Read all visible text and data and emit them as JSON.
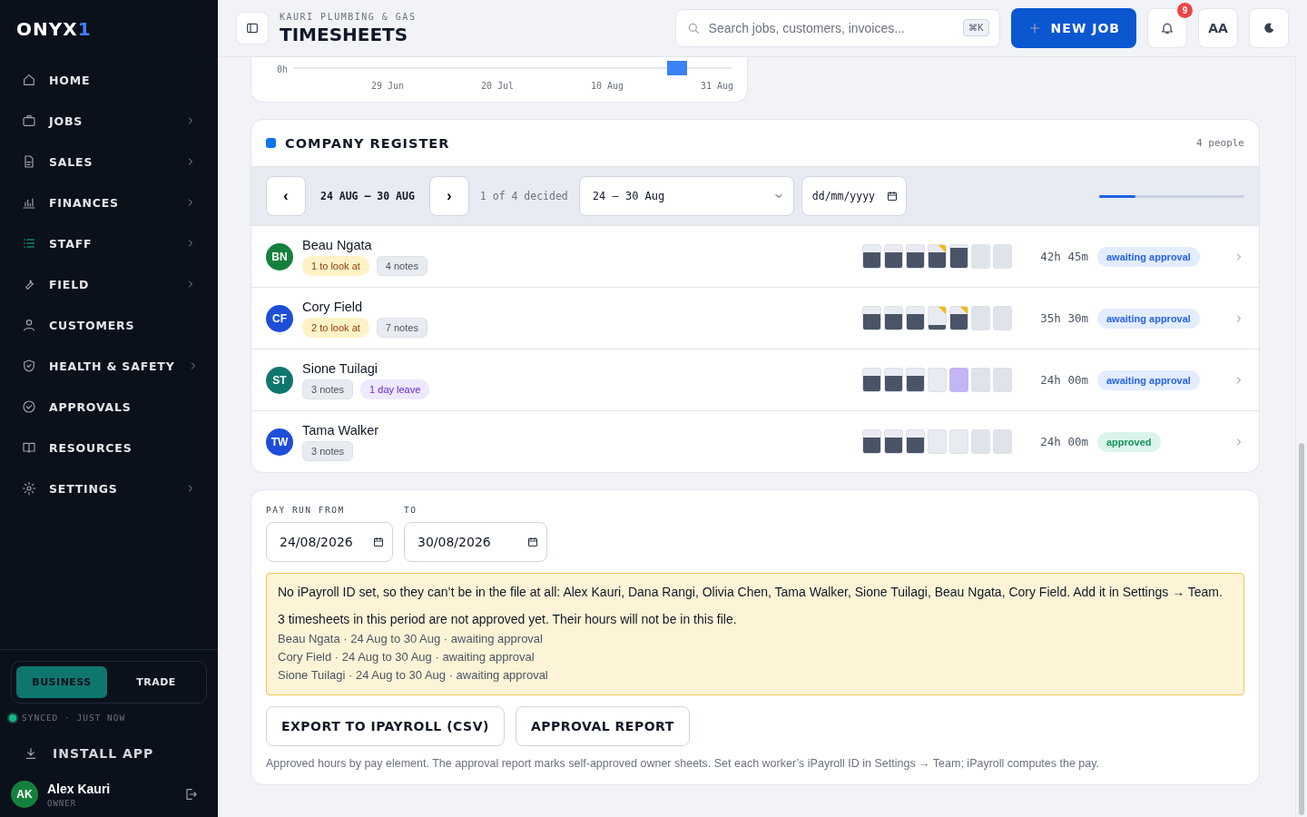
{
  "sidebar": {
    "logo": {
      "text": "ONYX",
      "accent": "1"
    },
    "items": [
      {
        "label": "HOME",
        "submenu": false,
        "selected": false
      },
      {
        "label": "JOBS",
        "submenu": true,
        "selected": false
      },
      {
        "label": "SALES",
        "submenu": true,
        "selected": false
      },
      {
        "label": "FINANCES",
        "submenu": true,
        "selected": false
      },
      {
        "label": "STAFF",
        "submenu": true,
        "selected": true
      },
      {
        "label": "FIELD",
        "submenu": true,
        "selected": false
      },
      {
        "label": "CUSTOMERS",
        "submenu": false,
        "selected": false
      },
      {
        "label": "HEALTH & SAFETY",
        "submenu": true,
        "selected": false
      },
      {
        "label": "APPROVALS",
        "submenu": false,
        "selected": false
      },
      {
        "label": "RESOURCES",
        "submenu": false,
        "selected": false
      },
      {
        "label": "SETTINGS",
        "submenu": true,
        "selected": false
      }
    ],
    "modes": [
      {
        "label": "BUSINESS",
        "selected": true
      },
      {
        "label": "TRADE",
        "selected": false
      }
    ],
    "sync_status": "SYNCED · JUST NOW",
    "install": "INSTALL APP",
    "user": {
      "initials": "AK",
      "name": "Alex Kauri",
      "role": "OWNER"
    }
  },
  "header": {
    "company": "KAURI PLUMBING & GAS",
    "title": "TIMESHEETS",
    "search": {
      "placeholder": "Search jobs, customers, invoices...",
      "shortcut": "⌘K"
    },
    "new_button": "NEW JOB",
    "notifications": "9",
    "text_size": "AA"
  },
  "chart": {
    "y_label": "0h",
    "x_labels": [
      "29 Jun",
      "20 Jul",
      "10 Aug",
      "31 Aug"
    ]
  },
  "register": {
    "title": "COMPANY REGISTER",
    "count": "4 people",
    "range": "24 AUG – 30 AUG",
    "prev": "‹",
    "next": "›",
    "decided": "1 of 4 decided",
    "level": 0.25,
    "week_select": "24 – 30 Aug",
    "date_placeholder": "dd/mm/yyyy",
    "rows": [
      {
        "initials": "BN",
        "color": "#15803d",
        "name": "Beau Ngata",
        "tags": [
          {
            "kind": "look",
            "text": "1 to look at"
          },
          {
            "kind": "notes",
            "text": "4 notes"
          }
        ],
        "days": [
          {
            "kind": "worked",
            "level": 0.7,
            "flag": false
          },
          {
            "kind": "worked",
            "level": 0.7,
            "flag": false
          },
          {
            "kind": "worked",
            "level": 0.7,
            "flag": false
          },
          {
            "kind": "worked",
            "level": 0.7,
            "flag": true
          },
          {
            "kind": "worked",
            "level": 0.9,
            "flag": false
          },
          {
            "kind": "weekend"
          },
          {
            "kind": "weekend"
          }
        ],
        "hours": "42h 45m",
        "status": {
          "kind": "awaiting",
          "text": "awaiting approval"
        }
      },
      {
        "initials": "CF",
        "color": "#1d4ed8",
        "name": "Cory Field",
        "tags": [
          {
            "kind": "look",
            "text": "2 to look at"
          },
          {
            "kind": "notes",
            "text": "7 notes"
          }
        ],
        "days": [
          {
            "kind": "worked",
            "level": 0.7,
            "flag": false
          },
          {
            "kind": "worked",
            "level": 0.7,
            "flag": false
          },
          {
            "kind": "worked",
            "level": 0.7,
            "flag": false
          },
          {
            "kind": "worked",
            "level": 0.2,
            "flag": true
          },
          {
            "kind": "worked",
            "level": 0.7,
            "flag": true
          },
          {
            "kind": "weekend"
          },
          {
            "kind": "weekend"
          }
        ],
        "hours": "35h 30m",
        "status": {
          "kind": "awaiting",
          "text": "awaiting approval"
        }
      },
      {
        "initials": "ST",
        "color": "#0f766e",
        "name": "Sione Tuilagi",
        "tags": [
          {
            "kind": "notes",
            "text": "3 notes"
          },
          {
            "kind": "leave",
            "text": "1 day leave"
          }
        ],
        "days": [
          {
            "kind": "worked",
            "level": 0.7,
            "flag": false
          },
          {
            "kind": "worked",
            "level": 0.7,
            "flag": false
          },
          {
            "kind": "worked",
            "level": 0.7,
            "flag": false
          },
          {
            "kind": "empty"
          },
          {
            "kind": "leave"
          },
          {
            "kind": "weekend"
          },
          {
            "kind": "weekend"
          }
        ],
        "hours": "24h 00m",
        "status": {
          "kind": "awaiting",
          "text": "awaiting approval"
        }
      },
      {
        "initials": "TW",
        "color": "#1d4ed8",
        "name": "Tama Walker",
        "tags": [
          {
            "kind": "notes",
            "text": "3 notes"
          }
        ],
        "days": [
          {
            "kind": "worked",
            "level": 0.7,
            "flag": false
          },
          {
            "kind": "worked",
            "level": 0.7,
            "flag": false
          },
          {
            "kind": "worked",
            "level": 0.7,
            "flag": false
          },
          {
            "kind": "empty"
          },
          {
            "kind": "empty"
          },
          {
            "kind": "weekend"
          },
          {
            "kind": "weekend"
          }
        ],
        "hours": "24h 00m",
        "status": {
          "kind": "approved",
          "text": "approved"
        }
      }
    ]
  },
  "pay_run": {
    "from_label": "PAY RUN FROM",
    "from": "24/08/2026",
    "to_label": "TO",
    "to": "30/08/2026",
    "warning": {
      "missing_ids": "No iPayroll ID set, so they can’t be in the file at all: Alex Kauri, Dana Rangi, Olivia Chen, Tama Walker, Sione Tuilagi, Beau Ngata, Cory Field. Add it in Settings → Team.",
      "unapproved": "3 timesheets in this period are not approved yet. Their hours will not be in this file.",
      "lines": [
        "Beau Ngata · 24 Aug to 30 Aug · awaiting approval",
        "Cory Field · 24 Aug to 30 Aug · awaiting approval",
        "Sione Tuilagi · 24 Aug to 30 Aug · awaiting approval"
      ]
    },
    "buttons": [
      "EXPORT TO IPAYROLL (CSV)",
      "APPROVAL REPORT"
    ],
    "note": "Approved hours by pay element. The approval report marks self-approved owner sheets. Set each worker’s iPayroll ID in Settings → Team; iPayroll computes the pay."
  }
}
